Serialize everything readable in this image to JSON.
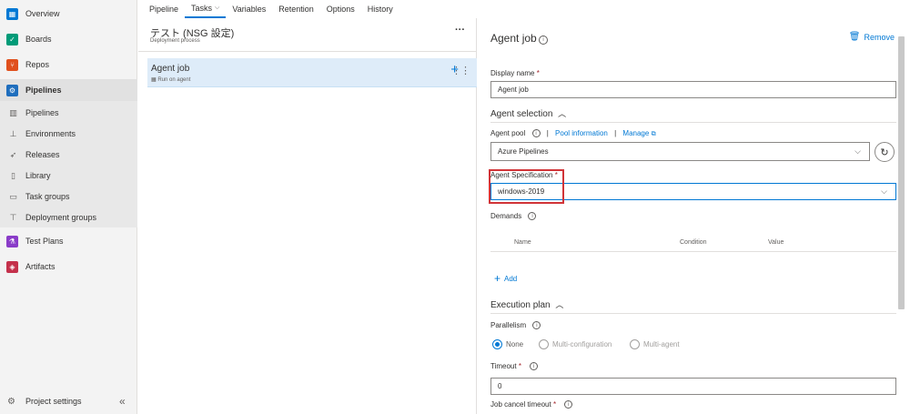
{
  "nav": {
    "overview": "Overview",
    "boards": "Boards",
    "repos": "Repos",
    "pipelines": "Pipelines",
    "sub": [
      "Pipelines",
      "Environments",
      "Releases",
      "Library",
      "Task groups",
      "Deployment groups"
    ],
    "test_plans": "Test Plans",
    "artifacts": "Artifacts",
    "project_settings": "Project settings"
  },
  "tabs": [
    "Pipeline",
    "Tasks",
    "Variables",
    "Retention",
    "Options",
    "History"
  ],
  "process": {
    "title": "テスト (NSG 設定)",
    "subtitle": "Deployment process"
  },
  "job": {
    "title": "Agent job",
    "subtitle": "Run on agent"
  },
  "panel": {
    "title": "Agent job",
    "remove": "Remove",
    "display_name_label": "Display name",
    "display_name_value": "Agent job",
    "agent_selection": "Agent selection",
    "agent_pool_label": "Agent pool",
    "pool_info": "Pool information",
    "manage": "Manage",
    "agent_pool_value": "Azure Pipelines",
    "agent_spec_label": "Agent Specification",
    "agent_spec_value": "windows-2019",
    "demands_label": "Demands",
    "col_name": "Name",
    "col_condition": "Condition",
    "col_value": "Value",
    "add": "Add",
    "execution_plan": "Execution plan",
    "parallelism_label": "Parallelism",
    "radio_none": "None",
    "radio_multi_config": "Multi-configuration",
    "radio_multi_agent": "Multi-agent",
    "timeout_label": "Timeout",
    "timeout_value": "0",
    "cancel_timeout_label": "Job cancel timeout"
  },
  "colors": {
    "accent": "#0078d4",
    "highlight": "#d13438"
  }
}
